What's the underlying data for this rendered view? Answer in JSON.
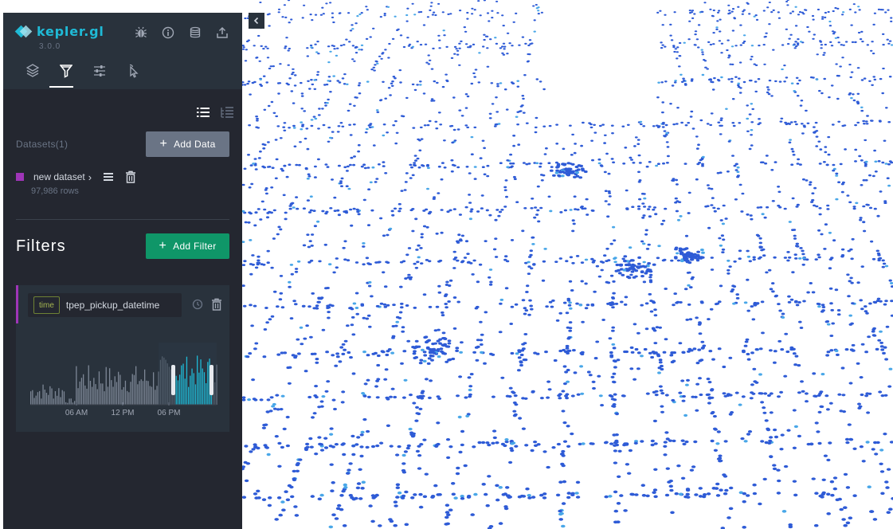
{
  "app": {
    "name": "kepler.gl",
    "version": "3.0.0"
  },
  "header": {
    "icons": [
      "bug-icon",
      "info-icon",
      "database-icon",
      "share-icon"
    ],
    "tabs": [
      {
        "name": "layers",
        "icon": "layers-icon"
      },
      {
        "name": "filters",
        "icon": "filter-icon",
        "active": true
      },
      {
        "name": "interactions",
        "icon": "sliders-icon"
      },
      {
        "name": "base-map",
        "icon": "cursor-icon"
      }
    ]
  },
  "datasets": {
    "label": "Datasets(1)",
    "add_data_label": "Add Data",
    "items": [
      {
        "name": "new dataset",
        "rows": "97,986 rows",
        "color": "#9f35b8"
      }
    ]
  },
  "filters": {
    "title": "Filters",
    "add_filter_label": "Add Filter",
    "items": [
      {
        "type": "time",
        "field": "tpep_pickup_datetime",
        "axis_labels": [
          "06 AM",
          "12 PM",
          "06 PM"
        ]
      }
    ]
  },
  "colors": {
    "sidebar_bg": "#242730",
    "header_bg": "#29323c",
    "accent": "#1fbad6",
    "add_filter": "#0f9668",
    "histogram_selected": "#1fbad6",
    "histogram_unselected": "#6a7485",
    "points": "#2e5bd6"
  }
}
